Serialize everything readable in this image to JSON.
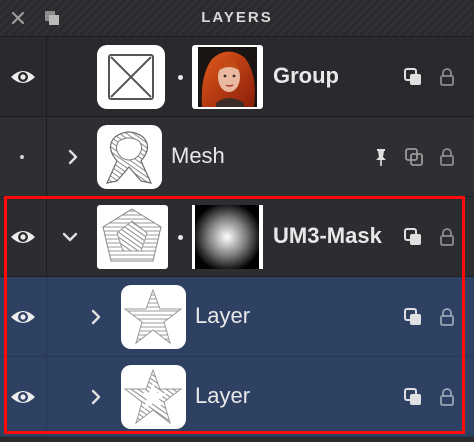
{
  "panel": {
    "title": "LAYERS"
  },
  "titlebar_icons": [
    "close-icon",
    "duplicate-icon"
  ],
  "layers": [
    {
      "name": "Group",
      "visible": true,
      "expandable": false,
      "icons": [
        "clip-icon",
        "lock-icon"
      ]
    },
    {
      "name": "Mesh",
      "visible": false,
      "expandable": true,
      "expanded": false,
      "icons": [
        "pin-icon",
        "clip-icon",
        "lock-icon"
      ]
    },
    {
      "name": "UM3-Mask",
      "visible": true,
      "expandable": true,
      "expanded": true,
      "icons": [
        "clip-icon",
        "lock-icon"
      ]
    },
    {
      "name": "Layer",
      "visible": true,
      "expandable": true,
      "expanded": false,
      "selected": true,
      "icons": [
        "clip-icon",
        "lock-icon"
      ]
    },
    {
      "name": "Layer",
      "visible": true,
      "expandable": true,
      "expanded": false,
      "selected": true,
      "icons": [
        "clip-icon",
        "lock-icon"
      ]
    }
  ],
  "colors": {
    "highlight": "#ff0a0a",
    "selected_row": "#2e4162",
    "panel_bg": "#2a2b2e"
  }
}
